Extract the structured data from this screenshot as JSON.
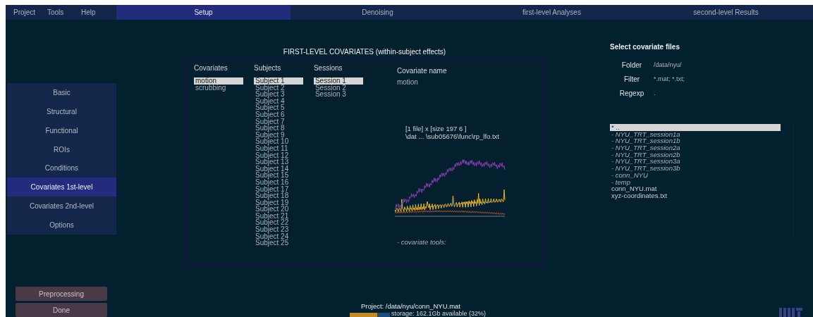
{
  "menu": [
    "Project",
    "Tools",
    "Help"
  ],
  "tabs": [
    {
      "label": "Setup",
      "selected": true
    },
    {
      "label": "Denoising",
      "selected": false
    },
    {
      "label": "first-level Analyses",
      "selected": false
    },
    {
      "label": "second-level Results",
      "selected": false
    }
  ],
  "sidebar": {
    "items": [
      {
        "label": "Basic",
        "selected": false
      },
      {
        "label": "Structural",
        "selected": false
      },
      {
        "label": "Functional",
        "selected": false
      },
      {
        "label": "ROIs",
        "selected": false
      },
      {
        "label": "Conditions",
        "selected": false
      },
      {
        "label": "Covariates 1st-level",
        "selected": true
      },
      {
        "label": "Covariates 2nd-level",
        "selected": false
      },
      {
        "label": "Options",
        "selected": false
      }
    ]
  },
  "covariates_panel": {
    "title": "FIRST-LEVEL COVARIATES (within-subject effects)",
    "lists": [
      {
        "heading": "Covariates",
        "items": [
          {
            "label": "motion",
            "selected": true
          },
          {
            "label": "scrubbing",
            "selected": false
          }
        ]
      },
      {
        "heading": "Subjects",
        "items": [
          {
            "label": "Subject 1",
            "selected": true
          },
          {
            "label": "Subject 2",
            "selected": false
          },
          {
            "label": "Subject 3",
            "selected": false
          },
          {
            "label": "Subject 4",
            "selected": false
          },
          {
            "label": "Subject 5",
            "selected": false
          },
          {
            "label": "Subject 6",
            "selected": false
          },
          {
            "label": "Subject 7",
            "selected": false
          },
          {
            "label": "Subject 8",
            "selected": false
          },
          {
            "label": "Subject 9",
            "selected": false
          },
          {
            "label": "Subject 10",
            "selected": false
          },
          {
            "label": "Subject 11",
            "selected": false
          },
          {
            "label": "Subject 12",
            "selected": false
          },
          {
            "label": "Subject 13",
            "selected": false
          },
          {
            "label": "Subject 14",
            "selected": false
          },
          {
            "label": "Subject 15",
            "selected": false
          },
          {
            "label": "Subject 16",
            "selected": false
          },
          {
            "label": "Subject 17",
            "selected": false
          },
          {
            "label": "Subject 18",
            "selected": false
          },
          {
            "label": "Subject 19",
            "selected": false
          },
          {
            "label": "Subject 20",
            "selected": false
          },
          {
            "label": "Subject 21",
            "selected": false
          },
          {
            "label": "Subject 22",
            "selected": false
          },
          {
            "label": "Subject 23",
            "selected": false
          },
          {
            "label": "Subject 24",
            "selected": false
          },
          {
            "label": "Subject 25",
            "selected": false
          }
        ]
      },
      {
        "heading": "Sessions",
        "items": [
          {
            "label": "Session 1",
            "selected": true
          },
          {
            "label": "Session 2",
            "selected": false
          },
          {
            "label": "Session 3",
            "selected": false
          }
        ]
      }
    ],
    "name_label": "Covariate name",
    "name_value": "motion",
    "file_info": [
      "[1 file] x [size 197 6 ]",
      "\\dat ... \\sub05676\\func\\rp_lfo.txt"
    ],
    "tools_label": "- covariate tools:"
  },
  "file_selector": {
    "title": "Select covariate files",
    "fields": [
      {
        "label": "Folder",
        "value": "/data/nyu/"
      },
      {
        "label": "Filter",
        "value": "*.mat; *.txt;"
      },
      {
        "label": "Regexp",
        "value": "."
      }
    ],
    "files": [
      {
        "name": "* ..",
        "kind": "parent",
        "selected": true
      },
      {
        "name": "- NYU_TRT_session1a",
        "kind": "folder",
        "selected": false
      },
      {
        "name": "- NYU_TRT_session1b",
        "kind": "folder",
        "selected": false
      },
      {
        "name": "- NYU_TRT_session2a",
        "kind": "folder",
        "selected": false
      },
      {
        "name": "- NYU_TRT_session2b",
        "kind": "folder",
        "selected": false
      },
      {
        "name": "- NYU_TRT_session3a",
        "kind": "folder",
        "selected": false
      },
      {
        "name": "- NYU_TRT_session3b",
        "kind": "folder",
        "selected": false
      },
      {
        "name": "- conn_NYU",
        "kind": "folder",
        "selected": false
      },
      {
        "name": "- temp",
        "kind": "folder",
        "selected": false
      },
      {
        "name": "conn_NYU.mat",
        "kind": "file",
        "selected": false
      },
      {
        "name": "xyz-coordinates.txt",
        "kind": "file",
        "selected": false
      }
    ]
  },
  "buttons": [
    "Preprocessing",
    "Done"
  ],
  "status": {
    "project": "Project: /data/nyu/conn_NYU.mat",
    "storage": "storage: 162.1Gb available (32%)",
    "storage_level": {
      "level": 0.68
    }
  }
}
